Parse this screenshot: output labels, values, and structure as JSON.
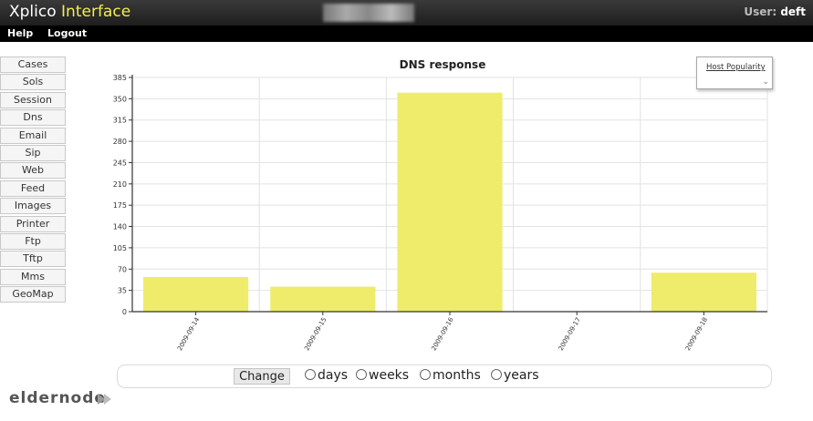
{
  "app": {
    "brand_prefix": "Xplico",
    "brand_accent": "Interface",
    "user_label": "User:",
    "user_name": "deft"
  },
  "menu": {
    "help": "Help",
    "logout": "Logout"
  },
  "sidebar": {
    "items": [
      "Cases",
      "Sols",
      "Session",
      "Dns",
      "Email",
      "Sip",
      "Web",
      "Feed",
      "Images",
      "Printer",
      "Ftp",
      "Tftp",
      "Mms",
      "GeoMap"
    ]
  },
  "popularity_link": "Host Popularity",
  "chart_data": {
    "type": "bar",
    "title": "DNS response",
    "categories": [
      "2009-09-14",
      "2009-09-15",
      "2009-09-16",
      "2009-09-17",
      "2009-09-18"
    ],
    "values": [
      57,
      41,
      360,
      0,
      64
    ],
    "ylim": [
      0,
      385
    ],
    "yticks": [
      0,
      35,
      70,
      105,
      140,
      175,
      210,
      245,
      280,
      315,
      350,
      385
    ],
    "grid": true,
    "color": "#eeec6a"
  },
  "controls": {
    "change_label": "Change",
    "periods": [
      "days",
      "weeks",
      "months",
      "years"
    ],
    "selected": "days"
  },
  "footer_logo": "eldernode"
}
